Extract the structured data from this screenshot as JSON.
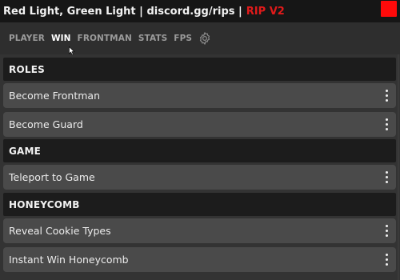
{
  "window": {
    "title": "Red Light, Green Light | discord.gg/rips |",
    "accent_title": "RIP V2",
    "accent_color": "#e11a1a",
    "close_color": "#ff0a0a"
  },
  "tabs": [
    {
      "label": "PLAYER",
      "active": false
    },
    {
      "label": "WIN",
      "active": true
    },
    {
      "label": "FRONTMAN",
      "active": false
    },
    {
      "label": "STATS",
      "active": false
    },
    {
      "label": "FPS",
      "active": false
    }
  ],
  "settings_icon": "gear-icon",
  "sections": [
    {
      "header": "ROLES",
      "items": [
        "Become Frontman",
        "Become Guard"
      ]
    },
    {
      "header": "GAME",
      "items": [
        "Teleport to Game"
      ]
    },
    {
      "header": "HONEYCOMB",
      "items": [
        "Reveal Cookie Types",
        "Instant Win Honeycomb"
      ]
    }
  ],
  "item_menu_icon": "kebab-menu-icon"
}
